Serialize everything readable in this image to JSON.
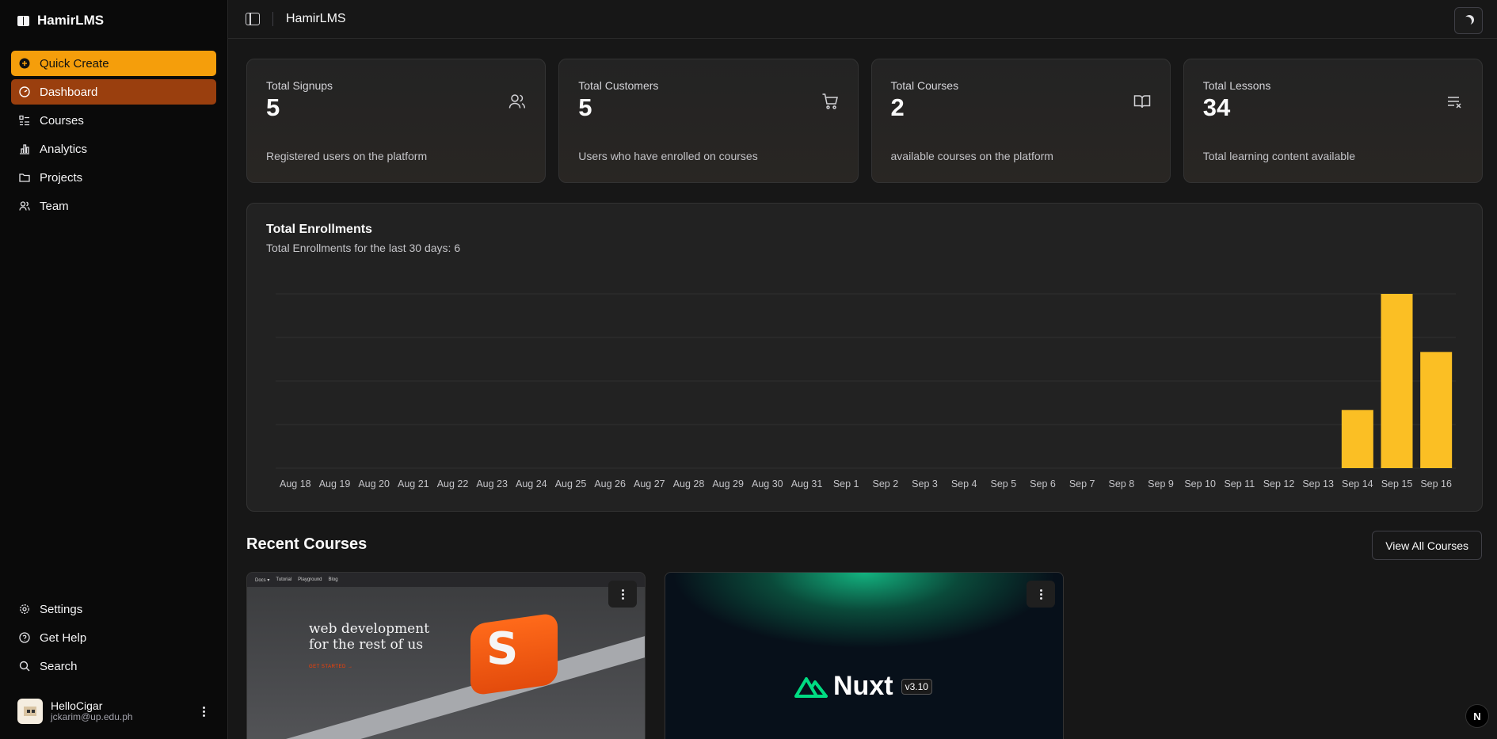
{
  "sidebar": {
    "brand": "HamirLMS",
    "items": [
      {
        "label": "Quick Create",
        "icon": "plus-circle-icon"
      },
      {
        "label": "Dashboard",
        "icon": "gauge-icon"
      },
      {
        "label": "Courses",
        "icon": "list-icon"
      },
      {
        "label": "Analytics",
        "icon": "bar-chart-icon"
      },
      {
        "label": "Projects",
        "icon": "folder-icon"
      },
      {
        "label": "Team",
        "icon": "users-icon"
      }
    ],
    "bottom": [
      {
        "label": "Settings",
        "icon": "gear-icon"
      },
      {
        "label": "Get Help",
        "icon": "help-icon"
      },
      {
        "label": "Search",
        "icon": "search-icon"
      }
    ],
    "user": {
      "name": "HelloCigar",
      "email": "jckarim@up.edu.ph"
    }
  },
  "header": {
    "title": "HamirLMS"
  },
  "stats": [
    {
      "label": "Total Signups",
      "value": "5",
      "desc": "Registered users on the platform",
      "icon": "users-icon"
    },
    {
      "label": "Total Customers",
      "value": "5",
      "desc": "Users who have enrolled on courses",
      "icon": "cart-icon"
    },
    {
      "label": "Total Courses",
      "value": "2",
      "desc": "available courses on the platform",
      "icon": "book-icon"
    },
    {
      "label": "Total Lessons",
      "value": "34",
      "desc": "Total learning content available",
      "icon": "list-x-icon"
    }
  ],
  "enrollments": {
    "title": "Total Enrollments",
    "subtitle": "Total Enrollments for the last 30 days: 6"
  },
  "chart_data": {
    "type": "bar",
    "title": "Total Enrollments",
    "categories": [
      "Aug 18",
      "Aug 19",
      "Aug 20",
      "Aug 21",
      "Aug 22",
      "Aug 23",
      "Aug 24",
      "Aug 25",
      "Aug 26",
      "Aug 27",
      "Aug 28",
      "Aug 29",
      "Aug 30",
      "Aug 31",
      "Sep 1",
      "Sep 2",
      "Sep 3",
      "Sep 4",
      "Sep 5",
      "Sep 6",
      "Sep 7",
      "Sep 8",
      "Sep 9",
      "Sep 10",
      "Sep 11",
      "Sep 12",
      "Sep 13",
      "Sep 14",
      "Sep 15",
      "Sep 16"
    ],
    "values": [
      0,
      0,
      0,
      0,
      0,
      0,
      0,
      0,
      0,
      0,
      0,
      0,
      0,
      0,
      0,
      0,
      0,
      0,
      0,
      0,
      0,
      0,
      0,
      0,
      0,
      0,
      0,
      1,
      3,
      2
    ],
    "ylim": [
      0,
      3
    ],
    "grid": true,
    "color": "#fbbf24"
  },
  "recent": {
    "title": "Recent Courses",
    "view_all": "View All Courses",
    "courses": [
      {
        "nav": [
          "Docs ▾",
          "Tutorial",
          "Playground",
          "Blog"
        ],
        "headline1": "web development",
        "headline2": "for the rest of us",
        "cta": "GET STARTED →"
      },
      {
        "wordmark": "Nuxt",
        "version": "v3.10"
      }
    ]
  },
  "corner": {
    "label": "N"
  }
}
